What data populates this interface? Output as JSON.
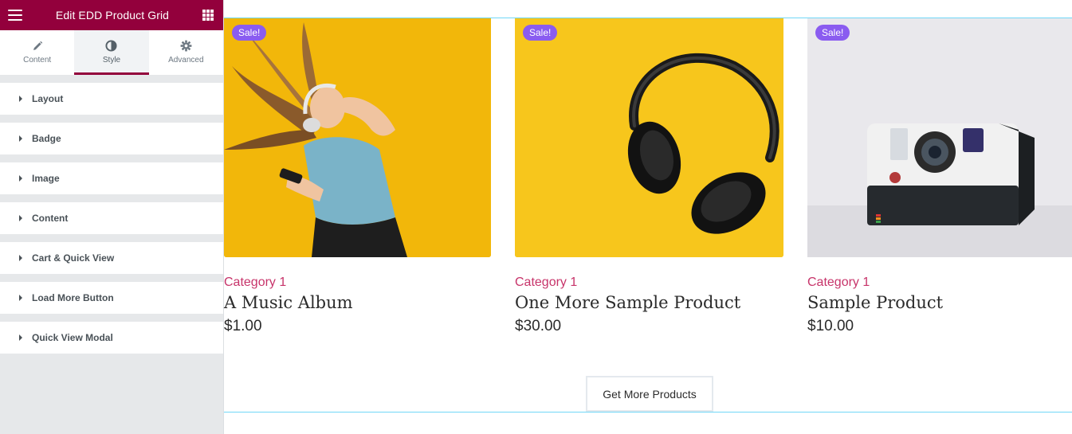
{
  "sidebar": {
    "title": "Edit EDD Product Grid",
    "tabs": [
      {
        "label": "Content",
        "icon": "pencil-icon"
      },
      {
        "label": "Style",
        "icon": "contrast-icon"
      },
      {
        "label": "Advanced",
        "icon": "gear-icon"
      }
    ],
    "active_tab": "Style",
    "sections": [
      "Layout",
      "Badge",
      "Image",
      "Content",
      "Cart & Quick View",
      "Load More Button",
      "Quick View Modal"
    ]
  },
  "products": [
    {
      "badge": "Sale!",
      "category": "Category 1",
      "name": "A Music Album",
      "price": "$1.00",
      "image": "woman-with-headphones"
    },
    {
      "badge": "Sale!",
      "category": "Category 1",
      "name": "One More Sample Product",
      "price": "$30.00",
      "image": "black-headphones"
    },
    {
      "badge": "Sale!",
      "category": "Category 1",
      "name": "Sample Product",
      "price": "$10.00",
      "image": "polaroid-camera"
    }
  ],
  "load_more_label": "Get More Products",
  "colors": {
    "brand": "#93003c",
    "badge": "#8a5cf0",
    "category": "#c7346a",
    "guide": "#71d7f7"
  }
}
